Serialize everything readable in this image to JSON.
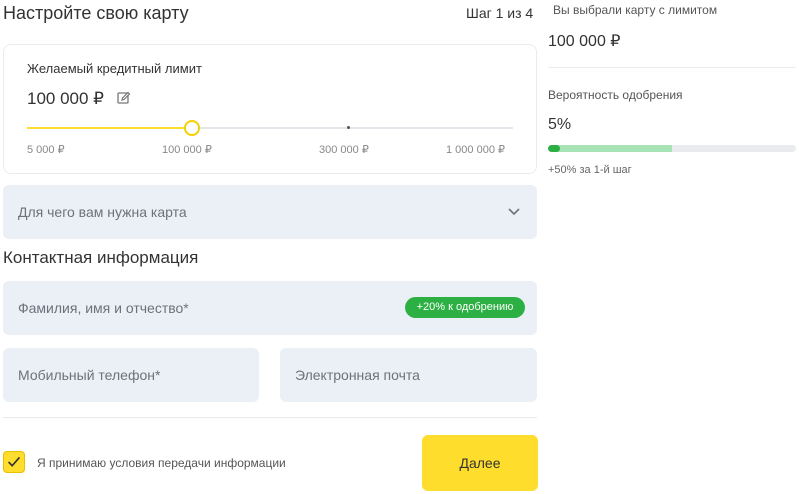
{
  "header": {
    "title": "Настройте свою карту",
    "step": "Шаг 1 из 4"
  },
  "limit": {
    "label": "Желаемый кредитный лимит",
    "value": "100 000 ₽",
    "slider_fraction": 0.337,
    "ticks": [
      "5 000 ₽",
      "100 000 ₽",
      "300 000 ₽",
      "1 000 000 ₽"
    ]
  },
  "purpose": {
    "placeholder": "Для чего вам нужна карта"
  },
  "contact": {
    "title": "Контактная информация",
    "fullname_placeholder": "Фамилия, имя и отчество*",
    "fullname_badge": "+20% к одобрению",
    "phone_placeholder": "Мобильный телефон*",
    "email_placeholder": "Электронная почта"
  },
  "consent": {
    "checked": true,
    "label": "Я принимаю условия передачи информации"
  },
  "actions": {
    "next_label": "Далее"
  },
  "summary": {
    "chosen_label": "Вы выбрали карту с лимитом",
    "chosen_value": "100 000 ₽",
    "approval_label": "Вероятность одобрения",
    "approval_value": "5%",
    "approval_fraction": 0.05,
    "approval_potential_fraction": 0.5,
    "boost_note": "+50% за 1-й шаг"
  },
  "colors": {
    "accent": "#ffdd2d",
    "success": "#2cb043",
    "field_bg": "#ebf0f6"
  }
}
